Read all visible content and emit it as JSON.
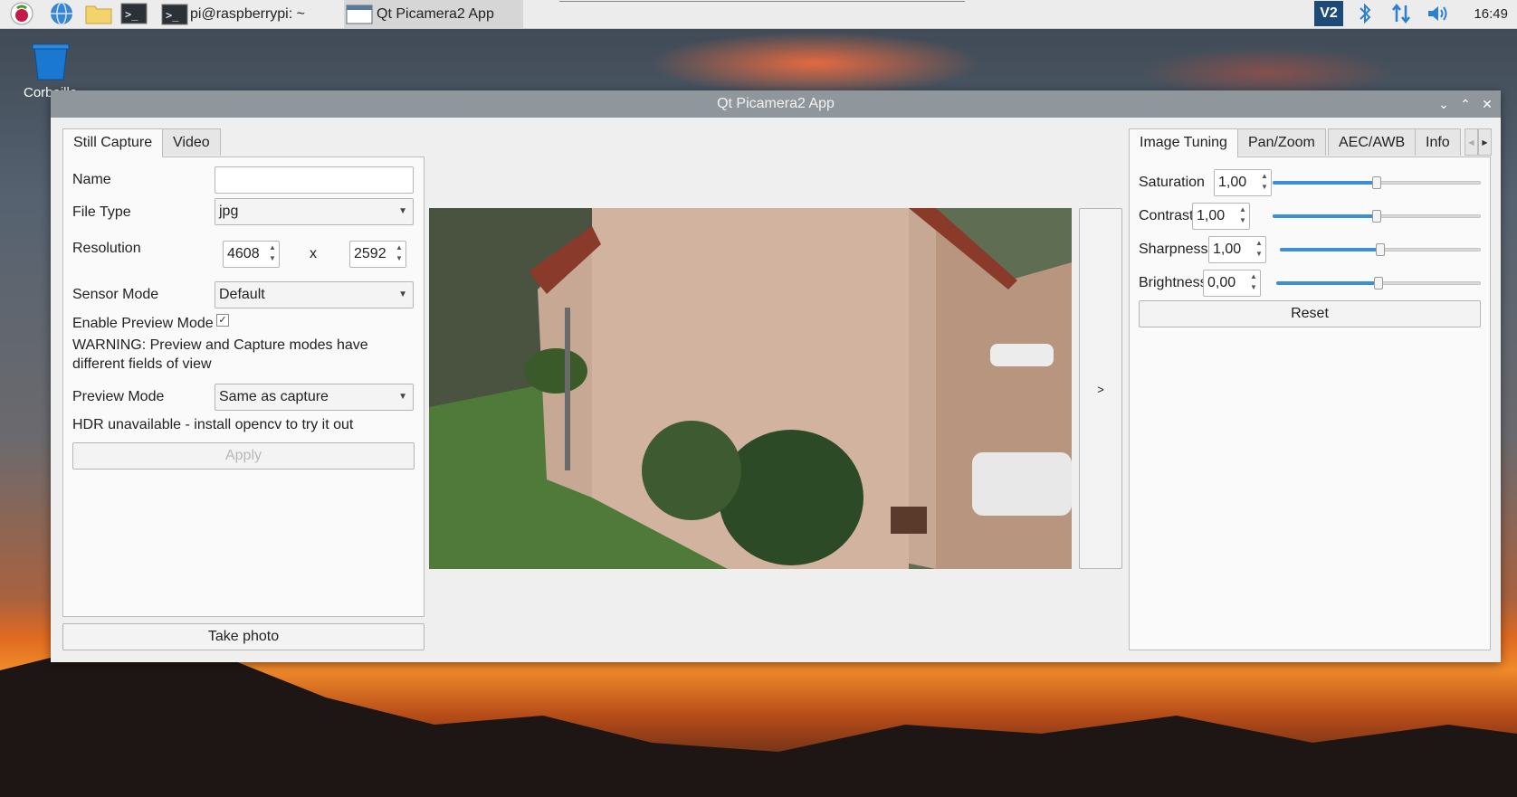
{
  "taskbar": {
    "terminal_task": "pi@raspberrypi: ~",
    "app_task": "Qt Picamera2 App",
    "clock": "16:49",
    "vnc_icon_text": "V2"
  },
  "desktop": {
    "trash_label": "Corbeille"
  },
  "window": {
    "title": "Qt Picamera2 App"
  },
  "left_tabs": [
    "Still Capture",
    "Video"
  ],
  "still": {
    "name_label": "Name",
    "name_value": "",
    "filetype_label": "File Type",
    "filetype_value": "jpg",
    "resolution_label": "Resolution",
    "res_width": "4608",
    "res_x": "x",
    "res_height": "2592",
    "sensor_label": "Sensor Mode",
    "sensor_value": "Default",
    "preview_enable_label": "Enable Preview Mode",
    "preview_enable_checked": "✓",
    "warning": "WARNING: Preview and Capture modes have different fields of view",
    "preview_mode_label": "Preview Mode",
    "preview_mode_value": "Same as capture",
    "hdr_note": "HDR unavailable - install opencv to try it out",
    "apply_label": "Apply",
    "take_photo_label": "Take photo"
  },
  "toggle_panel_label": ">",
  "right_tabs": [
    "Image Tuning",
    "Pan/Zoom",
    "AEC/AWB",
    "Info"
  ],
  "tuning": {
    "rows": [
      {
        "label": "Saturation",
        "value": "1,00",
        "level": 0.5
      },
      {
        "label": "Contrast",
        "value": "1,00",
        "level": 0.5
      },
      {
        "label": "Sharpness",
        "value": "1,00",
        "level": 0.5
      },
      {
        "label": "Brightness",
        "value": "0,00",
        "level": 0.5
      }
    ],
    "reset_label": "Reset"
  },
  "colors": {
    "accent": "#3b8fd6",
    "titlebar": "#8f969c"
  }
}
